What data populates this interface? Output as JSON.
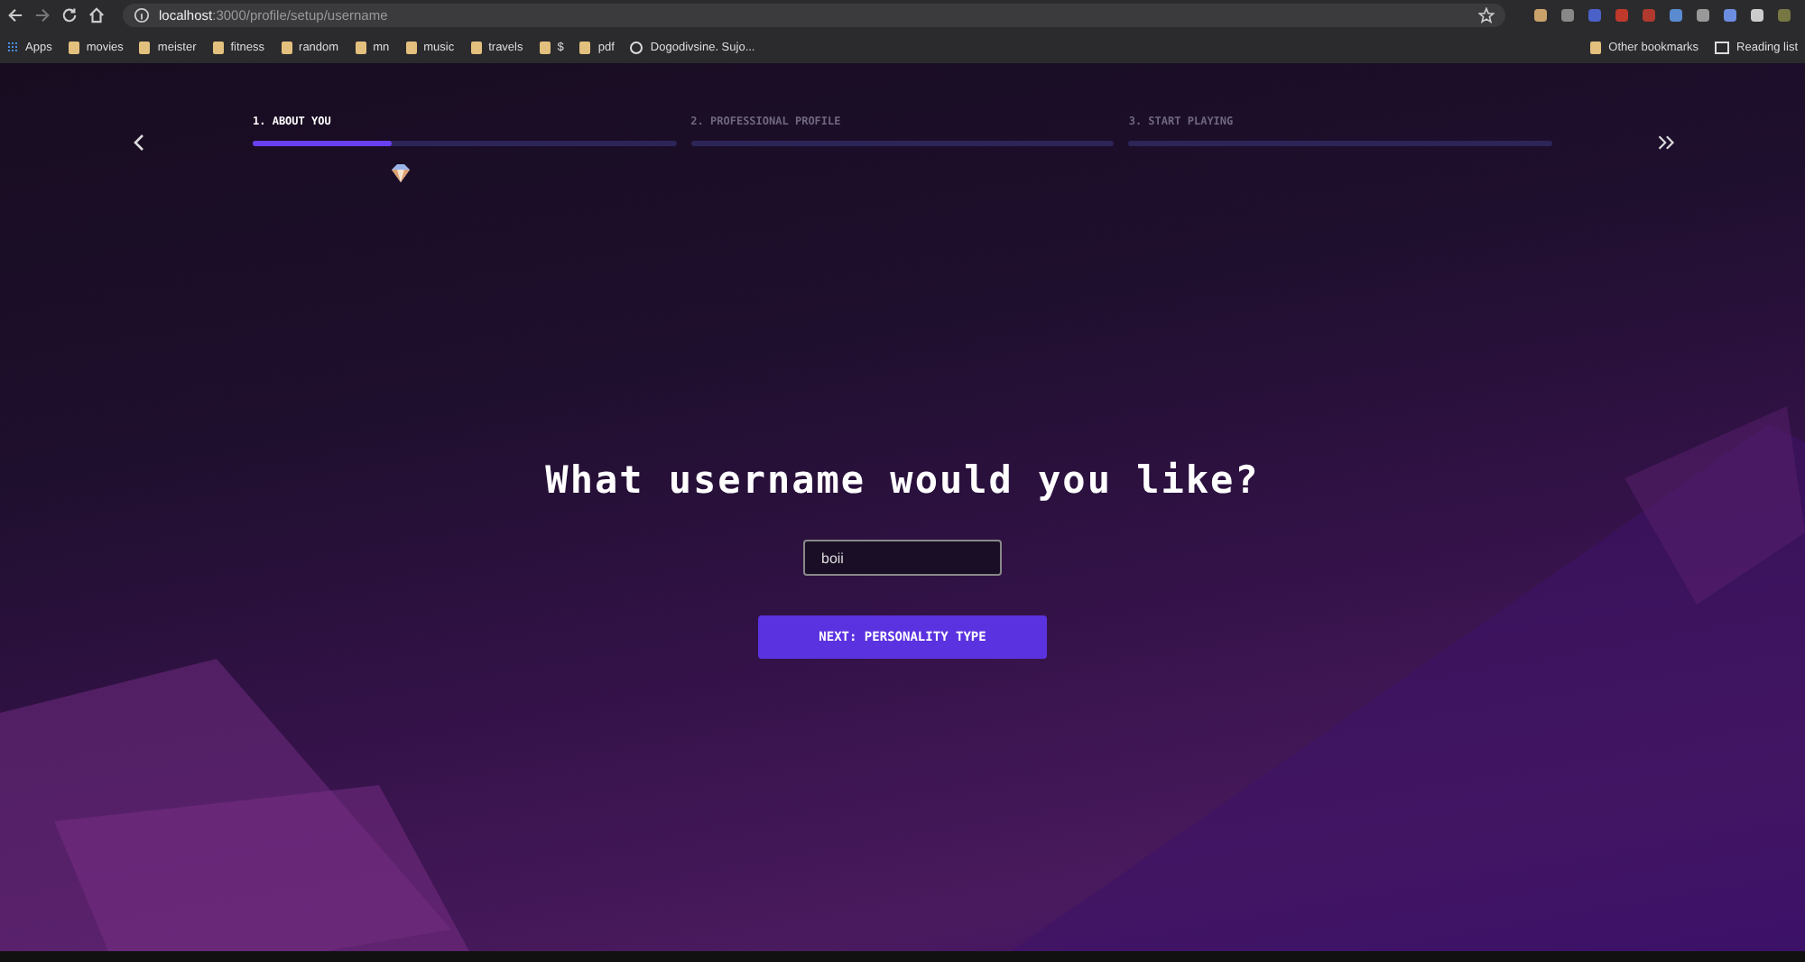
{
  "browser": {
    "url": {
      "host": "localhost",
      "path": ":3000/profile/setup/username"
    },
    "bookmarks": [
      {
        "label": "Apps",
        "kind": "apps"
      },
      {
        "label": "movies",
        "kind": "folder"
      },
      {
        "label": "meister",
        "kind": "folder"
      },
      {
        "label": "fitness",
        "kind": "folder"
      },
      {
        "label": "random",
        "kind": "folder"
      },
      {
        "label": "mn",
        "kind": "folder"
      },
      {
        "label": "music",
        "kind": "folder"
      },
      {
        "label": "travels",
        "kind": "folder"
      },
      {
        "label": "$",
        "kind": "folder"
      },
      {
        "label": "pdf",
        "kind": "folder"
      },
      {
        "label": "Dogodivsine. Sujo...",
        "kind": "site"
      }
    ],
    "right_bookmarks": [
      {
        "label": "Other bookmarks",
        "kind": "folder"
      },
      {
        "label": "Reading list",
        "kind": "reading"
      }
    ]
  },
  "steps": [
    {
      "label": "1. ABOUT YOU",
      "selected": true,
      "level": 0.33
    },
    {
      "label": "2. PROFESSIONAL PROFILE",
      "selected": false,
      "level": 0
    },
    {
      "label": "3. START PLAYING",
      "selected": false,
      "level": 0
    }
  ],
  "question": "What username would you like?",
  "username_field": {
    "value": "boii"
  },
  "next_button": "NEXT: PERSONALITY TYPE"
}
